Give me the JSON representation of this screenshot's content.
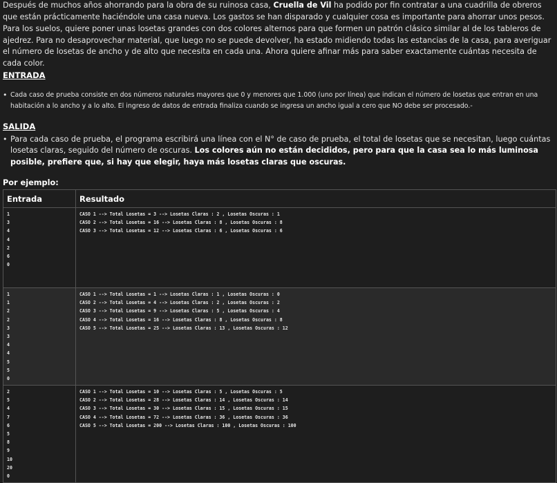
{
  "intro": {
    "p1_before": "Después de muchos años ahorrando para la obra de su ruinosa casa, ",
    "p1_bold": "Cruella de Vil",
    "p1_after": " ha podido por fin contratar a una cuadrilla de obreros que están prácticamente haciéndole una casa nueva. Los gastos se han disparado y cualquier cosa es importante para ahorrar unos pesos.",
    "p2": "Para los suelos, quiere poner unas losetas grandes con dos colores alternos para que formen un patrón clásico similar al de los tableros de ajedrez. Para no desaprovechar material, que luego no se puede devolver, ha estado midiendo todas las estancias de la casa, para averiguar el número de losetas de ancho y de alto que necesita en cada una. Ahora quiere afinar más para saber exactamente cuántas necesita de cada color."
  },
  "entrada": {
    "heading": "ENTRADA",
    "item": "Cada caso de prueba consiste en dos números naturales mayores que 0 y menores que 1.000 (uno por línea) que indican el número de losetas que entran en una habitación a lo ancho y a lo alto. El ingreso de datos de entrada finaliza cuando se ingresa un ancho  igual a cero que NO debe ser procesado.-"
  },
  "salida": {
    "heading": "SALIDA ",
    "item_plain": "Para cada caso de prueba, el programa escribirá una línea con el N° de caso de prueba, el total de losetas que se necesitan, luego cuántas losetas claras, seguido del número de oscuras. ",
    "item_bold": "Los colores aún no están decididos, pero para que la casa sea lo más luminosa posible, prefiere que, si hay que elegir, haya más losetas claras que oscuras."
  },
  "example_label": "Por ejemplo:",
  "table": {
    "headers": [
      "Entrada",
      "Resultado"
    ],
    "rows": [
      {
        "input": "1\n3\n4\n4\n2\n6\n0",
        "output": "CASO 1 --> Total Losetas = 3 --> Losetas Claras : 2 , Losetas Oscuras : 1\nCASO 2 --> Total Losetas = 16 --> Losetas Claras : 8 , Losetas Oscuras : 8\nCASO 3 --> Total Losetas = 12 --> Losetas Claras : 6 , Losetas Oscuras : 6"
      },
      {
        "input": "1\n1\n2\n2\n3\n3\n4\n4\n5\n5\n0",
        "output": "CASO 1 --> Total Losetas = 1 --> Losetas Claras : 1 , Losetas Oscuras : 0\nCASO 2 --> Total Losetas = 4 --> Losetas Claras : 2 , Losetas Oscuras : 2\nCASO 3 --> Total Losetas = 9 --> Losetas Claras : 5 , Losetas Oscuras : 4\nCASO 4 --> Total Losetas = 16 --> Losetas Claras : 8 , Losetas Oscuras : 8\nCASO 5 --> Total Losetas = 25 --> Losetas Claras : 13 , Losetas Oscuras : 12"
      },
      {
        "input": "2\n5\n4\n7\n6\n5\n8\n9\n10\n20\n0",
        "output": "CASO 1 --> Total Losetas = 10 --> Losetas Claras : 5 , Losetas Oscuras : 5\nCASO 2 --> Total Losetas = 28 --> Losetas Claras : 14 , Losetas Oscuras : 14\nCASO 3 --> Total Losetas = 30 --> Losetas Claras : 15 , Losetas Oscuras : 15\nCASO 4 --> Total Losetas = 72 --> Losetas Claras : 36 , Losetas Oscuras : 36\nCASO 5 --> Total Losetas = 200 --> Losetas Claras : 100 , Losetas Oscuras : 100"
      }
    ]
  }
}
